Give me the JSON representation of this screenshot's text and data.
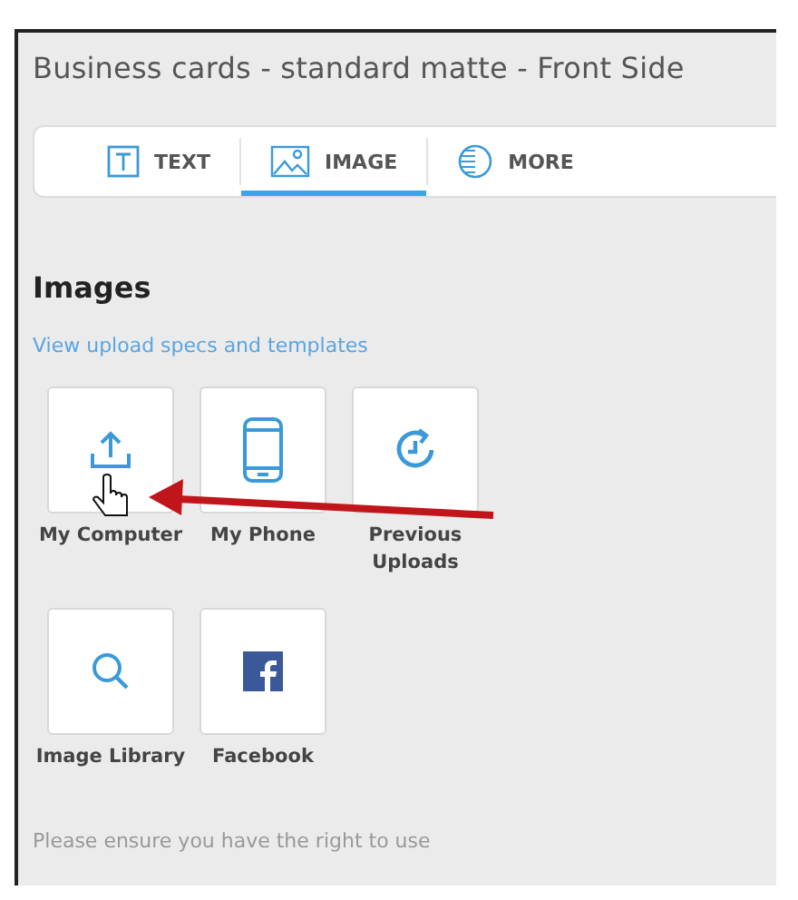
{
  "title": "Business cards - standard matte - Front Side",
  "tabs": [
    {
      "label": "TEXT",
      "kind": "text",
      "selected": false
    },
    {
      "label": "IMAGE",
      "kind": "image",
      "selected": true
    },
    {
      "label": "MORE",
      "kind": "more",
      "selected": false
    }
  ],
  "section_title": "Images",
  "link": "View upload specs and templates",
  "sources": [
    {
      "label": "My Computer",
      "kind": "upload"
    },
    {
      "label": "My Phone",
      "kind": "phone"
    },
    {
      "label": "Previous Uploads",
      "kind": "history"
    },
    {
      "label": "Image Library",
      "kind": "search"
    },
    {
      "label": "Facebook",
      "kind": "facebook"
    }
  ],
  "notice": "Please ensure you have the right to use"
}
